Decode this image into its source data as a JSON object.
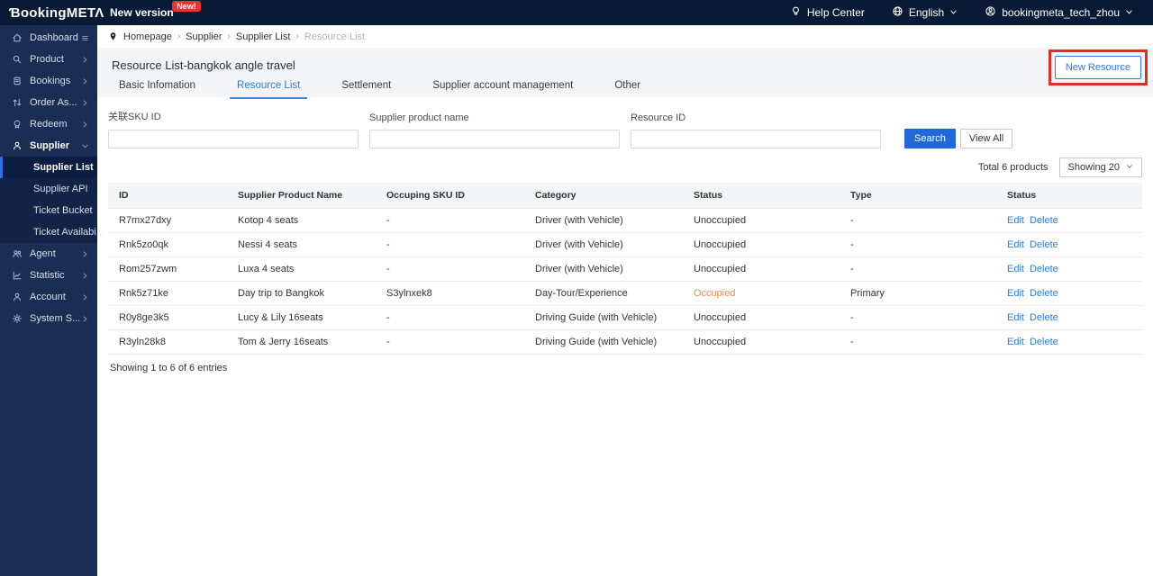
{
  "topbar": {
    "logo": "ƁookingMΕΤΛ",
    "new_version_label": "New version",
    "new_badge": "New!",
    "help_center_label": "Help Center",
    "language_label": "English",
    "username": "bookingmeta_tech_zhou"
  },
  "sidebar": {
    "items": [
      {
        "label": "Dashboard",
        "icon": "home-icon",
        "trailing": "menu-icon"
      },
      {
        "label": "Product",
        "icon": "search-icon",
        "trailing": "chevron-right-icon"
      },
      {
        "label": "Bookings",
        "icon": "clipboard-icon",
        "trailing": "chevron-right-icon"
      },
      {
        "label": "Order As...",
        "icon": "arrows-icon",
        "trailing": "chevron-right-icon"
      },
      {
        "label": "Redeem",
        "icon": "badge-icon",
        "trailing": "chevron-right-icon"
      },
      {
        "label": "Supplier",
        "icon": "person-icon",
        "trailing": "chevron-down-icon",
        "active_section": true,
        "children": [
          {
            "label": "Supplier List",
            "active": true
          },
          {
            "label": "Supplier API"
          },
          {
            "label": "Ticket Bucket"
          },
          {
            "label": "Ticket Availabi..."
          }
        ]
      },
      {
        "label": "Agent",
        "icon": "people-icon",
        "trailing": "chevron-right-icon"
      },
      {
        "label": "Statistic",
        "icon": "chart-icon",
        "trailing": "chevron-right-icon"
      },
      {
        "label": "Account",
        "icon": "user-icon",
        "trailing": "chevron-right-icon"
      },
      {
        "label": "System S...",
        "icon": "gear-icon",
        "trailing": "chevron-right-icon"
      }
    ]
  },
  "breadcrumb": {
    "items": [
      "Homepage",
      "Supplier",
      "Supplier List",
      "Resource List"
    ]
  },
  "page": {
    "title": "Resource List-bangkok angle travel",
    "new_resource_button": "New Resource",
    "tabs": [
      "Basic Infomation",
      "Resource List",
      "Settlement",
      "Supplier account management",
      "Other"
    ],
    "active_tab": "Resource List"
  },
  "filters": {
    "fields": [
      {
        "label": "关联SKU ID",
        "value": ""
      },
      {
        "label": "Supplier product name",
        "value": ""
      },
      {
        "label": "Resource ID",
        "value": ""
      }
    ],
    "search_button": "Search",
    "view_all_button": "View All"
  },
  "list": {
    "total_text": "Total 6 products",
    "page_size_label": "Showing 20",
    "columns": [
      "ID",
      "Supplier Product Name",
      "Occuping SKU ID",
      "Category",
      "Status",
      "Type",
      "Status"
    ],
    "rows": [
      {
        "id": "R7mx27dxy",
        "name": "Kotop 4 seats",
        "sku": "-",
        "category": "Driver  (with Vehicle)",
        "status": "Unoccupied",
        "type": "-",
        "actions": [
          "Edit",
          "Delete"
        ]
      },
      {
        "id": "Rnk5zo0qk",
        "name": "Nessi 4 seats",
        "sku": "-",
        "category": "Driver  (with Vehicle)",
        "status": "Unoccupied",
        "type": "-",
        "actions": [
          "Edit",
          "Delete"
        ]
      },
      {
        "id": "Rom257zwm",
        "name": "Luxa 4 seats",
        "sku": "-",
        "category": "Driver  (with Vehicle)",
        "status": "Unoccupied",
        "type": "-",
        "actions": [
          "Edit",
          "Delete"
        ]
      },
      {
        "id": "Rnk5z71ke",
        "name": "Day trip to Bangkok",
        "sku": "S3ylnxek8",
        "category": "Day-Tour/Experience",
        "status": "Occupied",
        "type": "Primary",
        "actions": [
          "Edit",
          "Delete"
        ]
      },
      {
        "id": "R0y8ge3k5",
        "name": "Lucy & Lily 16seats",
        "sku": "-",
        "category": "Driving Guide  (with Vehicle)",
        "status": "Unoccupied",
        "type": "-",
        "actions": [
          "Edit",
          "Delete"
        ]
      },
      {
        "id": "R3yln28k8",
        "name": "Tom & Jerry 16seats",
        "sku": "-",
        "category": "Driving Guide  (with Vehicle)",
        "status": "Unoccupied",
        "type": "-",
        "actions": [
          "Edit",
          "Delete"
        ]
      }
    ],
    "footer": "Showing 1 to 6 of 6 entries"
  },
  "colors": {
    "topbar_bg": "#081a36",
    "sidebar_bg": "#1a2e54",
    "submenu_bg": "#122348",
    "accent_blue": "#2b6fd8",
    "occupied_orange": "#ef8a4e",
    "highlight_red": "#e52c21",
    "badge_red": "#e5352c"
  }
}
